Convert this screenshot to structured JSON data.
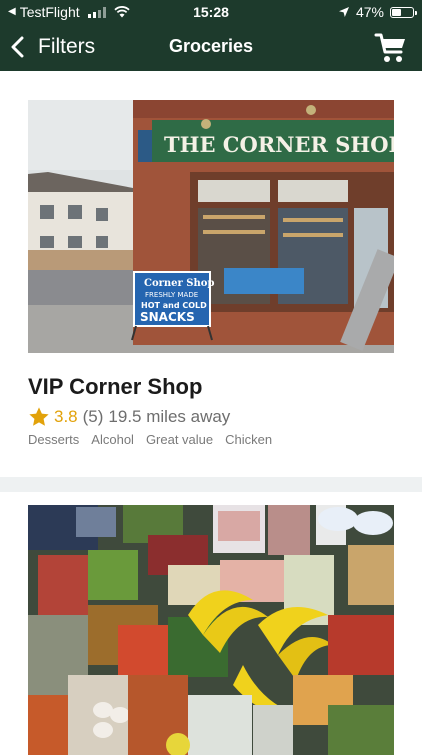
{
  "status_bar": {
    "back_app": "TestFlight",
    "time": "15:28",
    "battery_text": "47%",
    "battery_level": 0.47
  },
  "nav": {
    "back_label": "Filters",
    "title": "Groceries",
    "icons": {
      "back": "chevron-left-icon",
      "cart": "shopping-cart-icon"
    }
  },
  "stores": [
    {
      "name": "VIP Corner Shop",
      "rating": "3.8",
      "reviews": "(5)",
      "distance": "19.5 miles away",
      "tags": [
        "Desserts",
        "Alcohol",
        "Great value",
        "Chicken"
      ],
      "sign_text": "THE CORNER SHOP",
      "board_lines": [
        "Corner Shop",
        "FRESHLY MADE",
        "HOT and COLD",
        "SNACKS"
      ]
    },
    {}
  ],
  "colors": {
    "nav_bg": "#1d3a2c",
    "rating": "#e2a20a",
    "feed_bg": "#eef1f2"
  }
}
